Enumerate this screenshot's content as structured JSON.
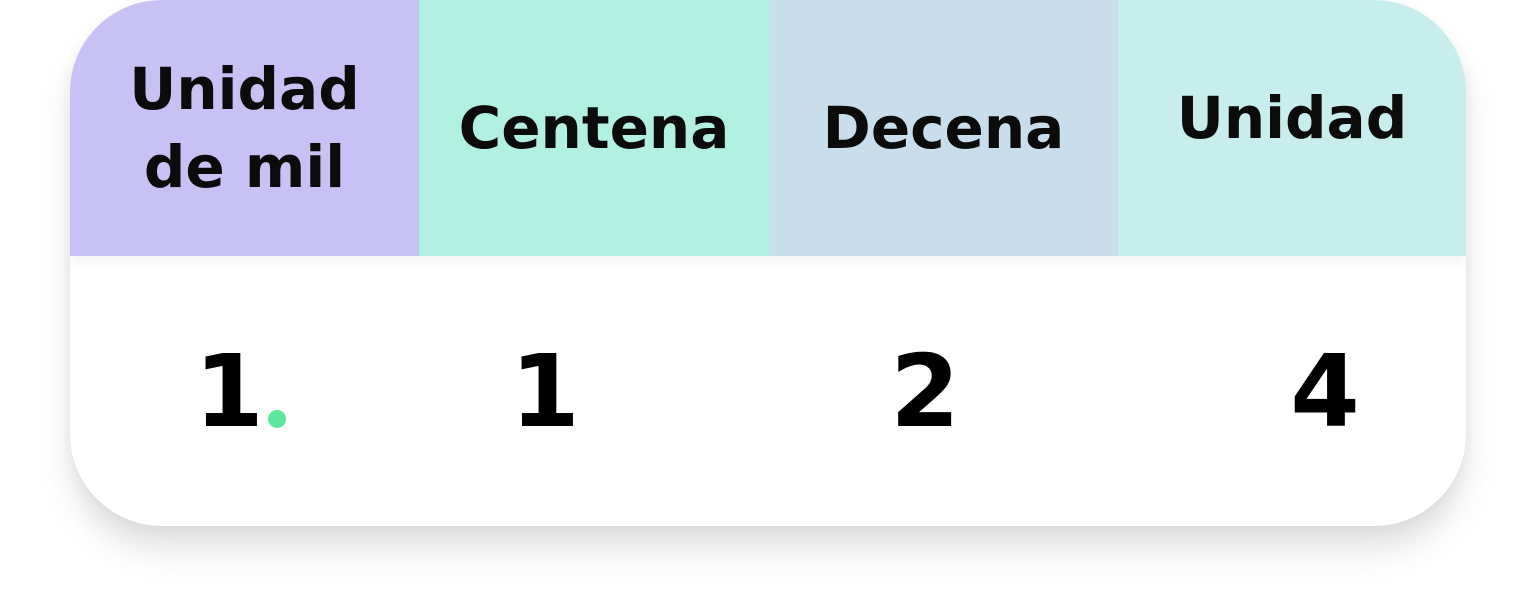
{
  "columns": [
    {
      "label_line1": "Unidad",
      "label_line2": "de mil",
      "color": "#c8c1f3",
      "value": "1"
    },
    {
      "label_line1": "Centena",
      "label_line2": "",
      "color": "#b2f1e1",
      "value": "1"
    },
    {
      "label_line1": "Decena",
      "label_line2": "",
      "color": "#c8deec",
      "value": "2"
    },
    {
      "label_line1": "Unidad",
      "label_line2": "",
      "color": "#c7eeed",
      "value": "4"
    }
  ],
  "separator": {
    "color": "#5ee79a"
  }
}
